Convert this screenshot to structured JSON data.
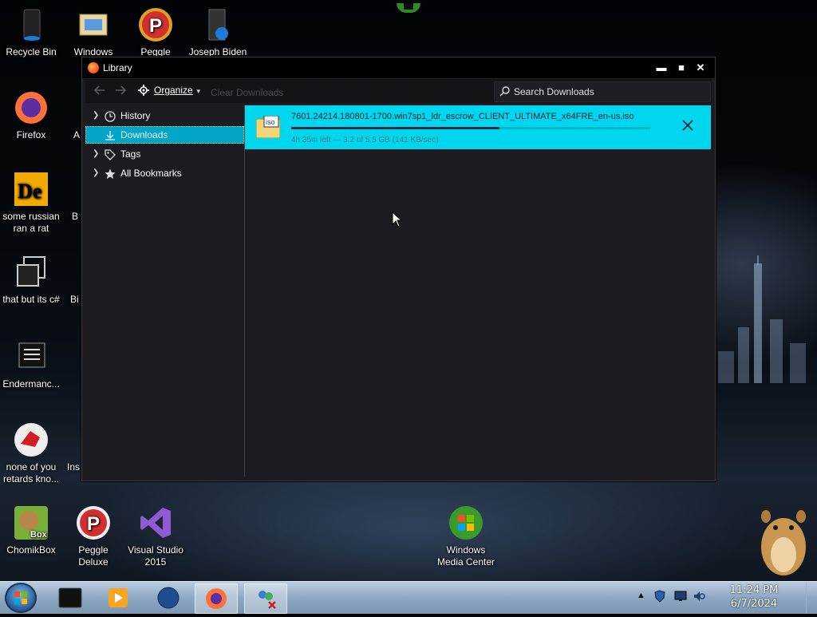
{
  "desktop": {
    "icons": [
      {
        "label": "Recycle Bin"
      },
      {
        "label": "Windows Live..."
      },
      {
        "label": "Peggle World..."
      },
      {
        "label": "Joseph Biden"
      },
      {
        "label": "Firefox"
      },
      {
        "label": "A"
      },
      {
        "label": "some russian ran a rat"
      },
      {
        "label": "B"
      },
      {
        "label": "that but its c#"
      },
      {
        "label": "Bi"
      },
      {
        "label": "Endermanc..."
      },
      {
        "label": "none of you retards kno..."
      },
      {
        "label": "Ins"
      },
      {
        "label": "ChomikBox"
      },
      {
        "label": "Peggle Deluxe"
      },
      {
        "label": "Visual Studio 2015"
      },
      {
        "label": "Windows Media Center"
      }
    ]
  },
  "window": {
    "title": "Library",
    "controls": {
      "minimize": "▬",
      "maximize": "■",
      "close": "✕"
    }
  },
  "toolbar": {
    "organize_label": "Organize",
    "clear_downloads_label": "Clear Downloads",
    "search_placeholder": "Search Downloads"
  },
  "sidebar": {
    "items": [
      {
        "label": "History",
        "icon": "clock-icon"
      },
      {
        "label": "Downloads",
        "icon": "download-icon",
        "selected": true
      },
      {
        "label": "Tags",
        "icon": "tag-icon"
      },
      {
        "label": "All Bookmarks",
        "icon": "star-icon"
      }
    ]
  },
  "downloads": [
    {
      "filename": "7601.24214.180801-1700.win7sp1_ldr_escrow_CLIENT_ULTIMATE_x64FRE_en-us.iso",
      "status": "4h 35m left — 3.2 of 5.5 GB (141 KB/sec)",
      "progress": 0.58,
      "file_badge": "iso"
    }
  ],
  "taskbar": {
    "clock_time": "11:24 PM",
    "clock_date": "6/7/2024"
  },
  "colors": {
    "selection": "#00a5c8",
    "download_row": "#00d7ef",
    "window_bg": "#1c1b22"
  }
}
